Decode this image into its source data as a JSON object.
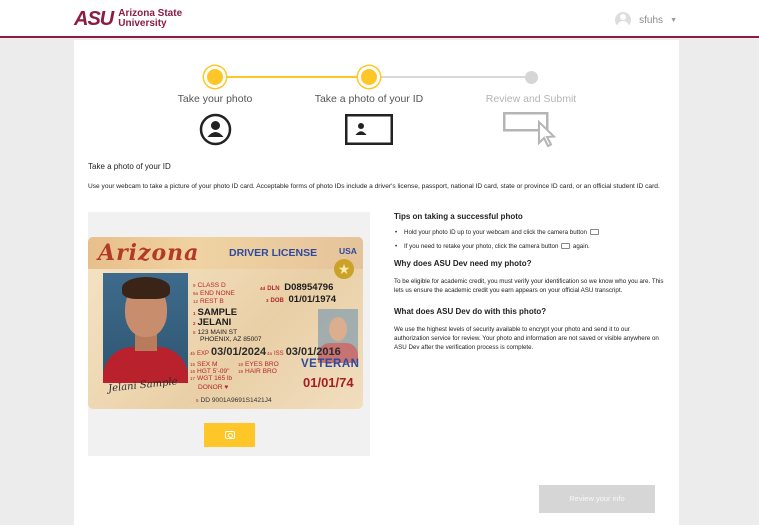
{
  "header": {
    "logo_mark": "ASU",
    "logo_line1": "Arizona State",
    "logo_line2": "University",
    "username": "sfuhs",
    "brand_color": "#8c1d40",
    "accent_color": "#ffc627"
  },
  "stepper": {
    "steps": [
      {
        "label": "Take your photo",
        "state": "complete",
        "icon": "person-circle-icon"
      },
      {
        "label": "Take a photo of your ID",
        "state": "current",
        "icon": "id-card-icon"
      },
      {
        "label": "Review and Submit",
        "state": "inactive",
        "icon": "review-cursor-icon"
      }
    ]
  },
  "section": {
    "title": "Take a photo of your ID",
    "description": "Use your webcam to take a picture of your photo ID card. Acceptable forms of photo IDs include a driver's license, passport, national ID card, state or province ID card, or an official student ID card."
  },
  "id_card": {
    "state": "Arizona",
    "type": "DRIVER LICENSE",
    "country": "USA",
    "class": "CLASS D",
    "end": "END  NONE",
    "rest": "REST  B",
    "dln_label": "DLN",
    "dln": "D08954796",
    "dob_label": "DOB",
    "dob": "01/01/1974",
    "last_name": "SAMPLE",
    "first_name": "JELANI",
    "address1": "123 MAIN ST",
    "address2": "PHOENIX, AZ 85007",
    "exp_label": "EXP",
    "exp": "03/01/2024",
    "iss_label": "ISS",
    "iss": "03/01/2016",
    "sex": "SEX  M",
    "eyes": "EYES BRO",
    "hgt": "HGT  5'-09\"",
    "hair": "HAIR BRO",
    "wgt": "WGT  165 lb",
    "donor": "DONOR",
    "veteran": "VETERAN",
    "dob_short": "01/01/74",
    "dd": "DD 9001A9691S1421J4",
    "signature": "Jelani Sample"
  },
  "tips": {
    "title": "Tips on taking a successful photo",
    "items": [
      "Hold your photo ID up to your webcam and click the camera button",
      "If you need to retake your photo, click the camera button",
      "again."
    ],
    "why_title": "Why does ASU Dev need my photo?",
    "why_text": "To be eligible for academic credit, you must verify your identification so we know who you are. This lets us ensure the academic credit you earn appears on your official ASU transcript.",
    "what_title": "What does ASU Dev do with this photo?",
    "what_text": "We use the highest levels of security available to encrypt your photo and send it to our authorization service for review. Your photo and information are not saved or visible anywhere on ASU Dev after the verification process is complete."
  },
  "actions": {
    "review_label": "Review your info"
  }
}
